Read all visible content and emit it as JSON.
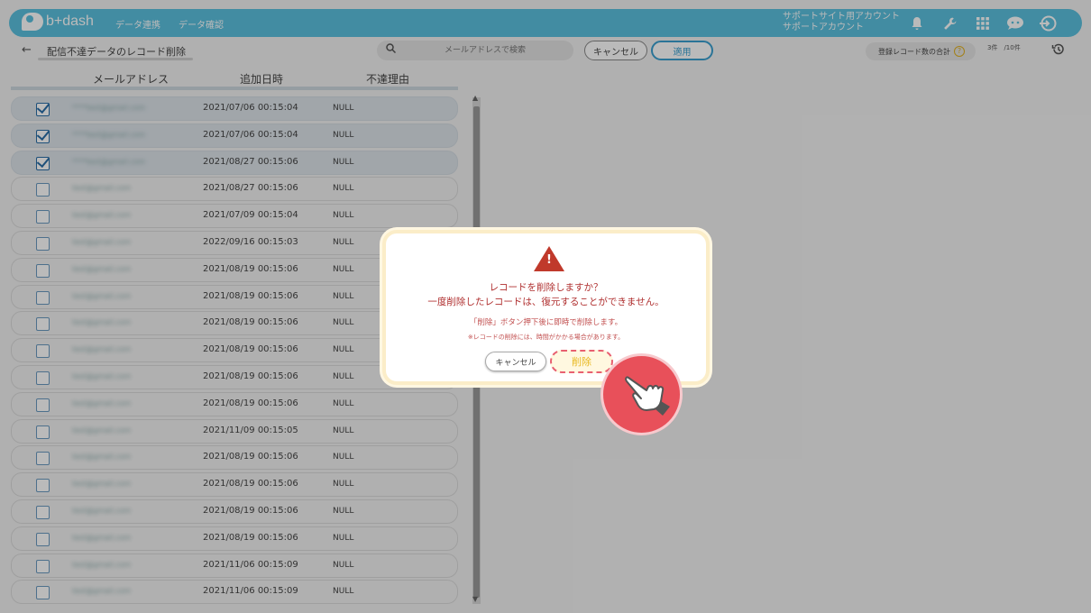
{
  "header": {
    "logo_text": "b+dash",
    "nav": [
      "データ連携",
      "データ確認"
    ],
    "account_line1": "サポートサイト用アカウント",
    "account_line2": "サポートアカウント",
    "icons": [
      "bell-icon",
      "wrench-icon",
      "grid-icon",
      "chat-icon",
      "logout-icon"
    ]
  },
  "toolbar": {
    "back": "←",
    "title": "配信不達データのレコード削除",
    "search_placeholder": "メールアドレスで検索",
    "cancel_label": "キャンセル",
    "apply_label": "適用",
    "count_label": "登録レコード数の合計",
    "help": "?",
    "count_value": "3件　/10件"
  },
  "table": {
    "headers": [
      "メールアドレス",
      "追加日時",
      "不達理由"
    ],
    "rows": [
      {
        "email": "****test@gmail.com",
        "date": "2021/07/06 00:15:04",
        "reason": "NULL",
        "checked": true
      },
      {
        "email": "****test@gmail.com",
        "date": "2021/07/06 00:15:04",
        "reason": "NULL",
        "checked": true
      },
      {
        "email": "****test@gmail.com",
        "date": "2021/08/27 00:15:06",
        "reason": "NULL",
        "checked": true
      },
      {
        "email": "test@gmail.com",
        "date": "2021/08/27 00:15:06",
        "reason": "NULL",
        "checked": false
      },
      {
        "email": "test@gmail.com",
        "date": "2021/07/09 00:15:04",
        "reason": "NULL",
        "checked": false
      },
      {
        "email": "test@gmail.com",
        "date": "2022/09/16 00:15:03",
        "reason": "NULL",
        "checked": false
      },
      {
        "email": "test@gmail.com",
        "date": "2021/08/19 00:15:06",
        "reason": "NULL",
        "checked": false
      },
      {
        "email": "test@gmail.com",
        "date": "2021/08/19 00:15:06",
        "reason": "NULL",
        "checked": false
      },
      {
        "email": "test@gmail.com",
        "date": "2021/08/19 00:15:06",
        "reason": "NULL",
        "checked": false
      },
      {
        "email": "test@gmail.com",
        "date": "2021/08/19 00:15:06",
        "reason": "NULL",
        "checked": false
      },
      {
        "email": "test@gmail.com",
        "date": "2021/08/19 00:15:06",
        "reason": "NULL",
        "checked": false
      },
      {
        "email": "test@gmail.com",
        "date": "2021/08/19 00:15:06",
        "reason": "NULL",
        "checked": false
      },
      {
        "email": "test@gmail.com",
        "date": "2021/11/09 00:15:05",
        "reason": "NULL",
        "checked": false
      },
      {
        "email": "test@gmail.com",
        "date": "2021/08/19 00:15:06",
        "reason": "NULL",
        "checked": false
      },
      {
        "email": "test@gmail.com",
        "date": "2021/08/19 00:15:06",
        "reason": "NULL",
        "checked": false
      },
      {
        "email": "test@gmail.com",
        "date": "2021/08/19 00:15:06",
        "reason": "NULL",
        "checked": false
      },
      {
        "email": "test@gmail.com",
        "date": "2021/08/19 00:15:06",
        "reason": "NULL",
        "checked": false
      },
      {
        "email": "test@gmail.com",
        "date": "2021/11/06 00:15:09",
        "reason": "NULL",
        "checked": false
      },
      {
        "email": "test@gmail.com",
        "date": "2021/11/06 00:15:09",
        "reason": "NULL",
        "checked": false
      }
    ]
  },
  "dialog": {
    "line1": "レコードを削除しますか？",
    "line2": "一度削除したレコードは、復元することができません。",
    "line3": "「削除」ボタン押下後に即時で削除します。",
    "line4": "※レコードの削除には、時間がかかる場合があります。",
    "cancel_label": "キャンセル",
    "delete_label": "削除"
  },
  "colors": {
    "brand": "#5bc0de",
    "warning": "#c0392b",
    "pointer": "#e8505a"
  }
}
